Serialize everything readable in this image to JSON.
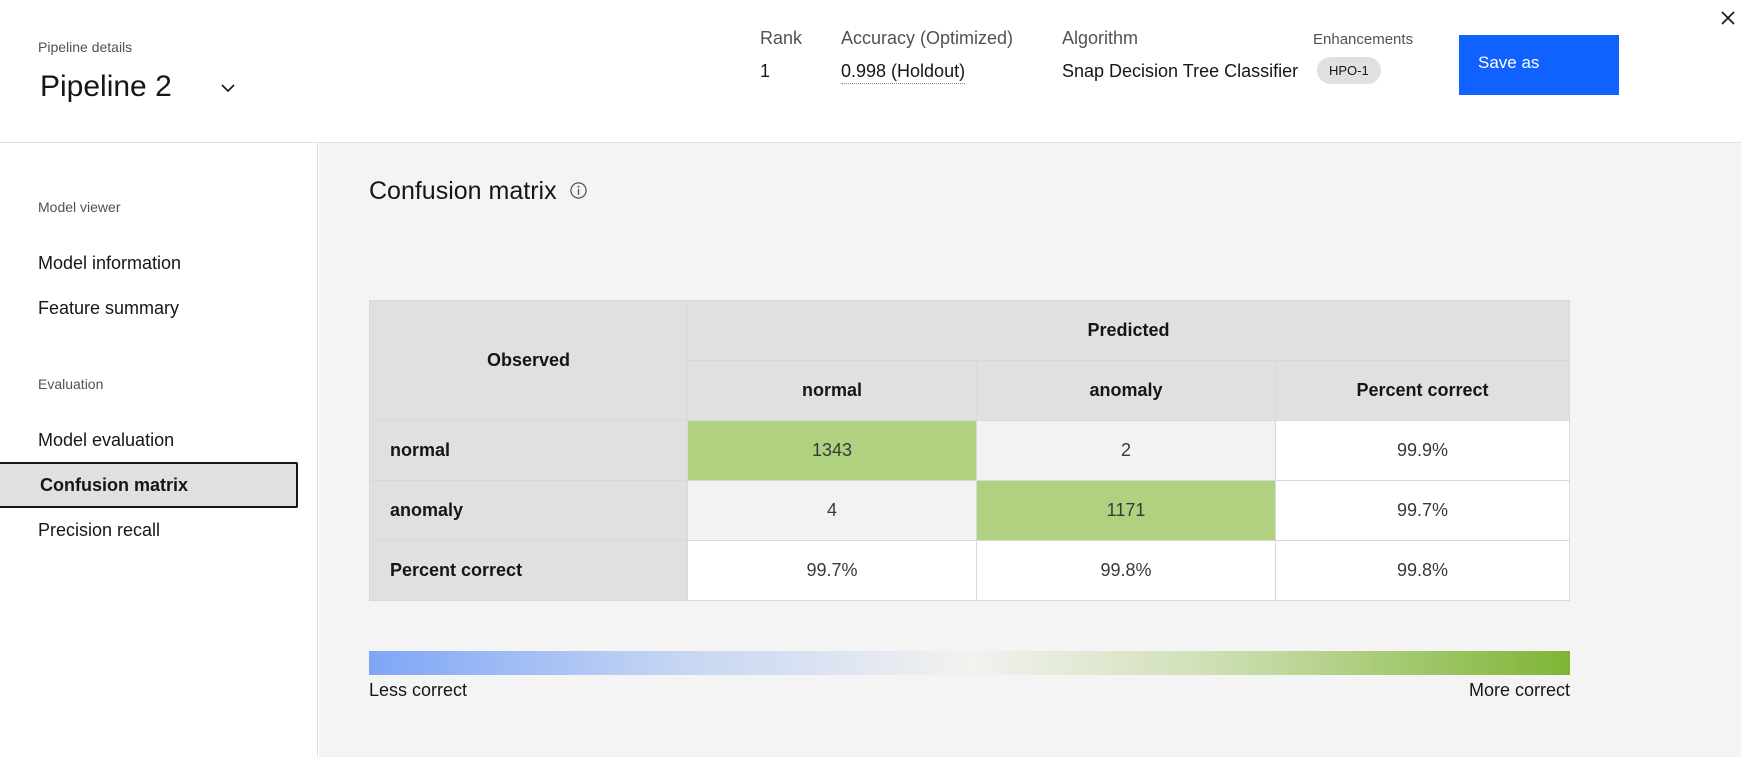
{
  "header": {
    "pipeline_details_label": "Pipeline details",
    "pipeline_name": "Pipeline 2",
    "rank_label": "Rank",
    "rank_value": "1",
    "accuracy_label": "Accuracy  (Optimized)",
    "accuracy_value": "0.998 (Holdout)",
    "algorithm_label": "Algorithm",
    "algorithm_value": "Snap Decision Tree Classifier",
    "enhancements_label": "Enhancements",
    "enhancements_tag": "HPO-1",
    "save_label": "Save as"
  },
  "sidebar": {
    "group1": "Model viewer",
    "items1": [
      "Model information",
      "Feature summary"
    ],
    "group2": "Evaluation",
    "items2": [
      "Model evaluation",
      "Confusion matrix",
      "Precision recall"
    ],
    "active_item": "Confusion matrix"
  },
  "main": {
    "title": "Confusion matrix",
    "table": {
      "observed_header": "Observed",
      "predicted_header": "Predicted",
      "columns": [
        "normal",
        "anomaly",
        "Percent correct"
      ],
      "rows": [
        {
          "label": "normal",
          "cells": [
            "1343",
            "2",
            "99.9%"
          ]
        },
        {
          "label": "anomaly",
          "cells": [
            "4",
            "1171",
            "99.7%"
          ]
        },
        {
          "label": "Percent correct",
          "cells": [
            "99.7%",
            "99.8%",
            "99.8%"
          ]
        }
      ]
    },
    "legend": {
      "left": "Less correct",
      "right": "More correct"
    }
  },
  "colors": {
    "accent": "#0f62fe",
    "correct_cell": "#b0d17f"
  }
}
